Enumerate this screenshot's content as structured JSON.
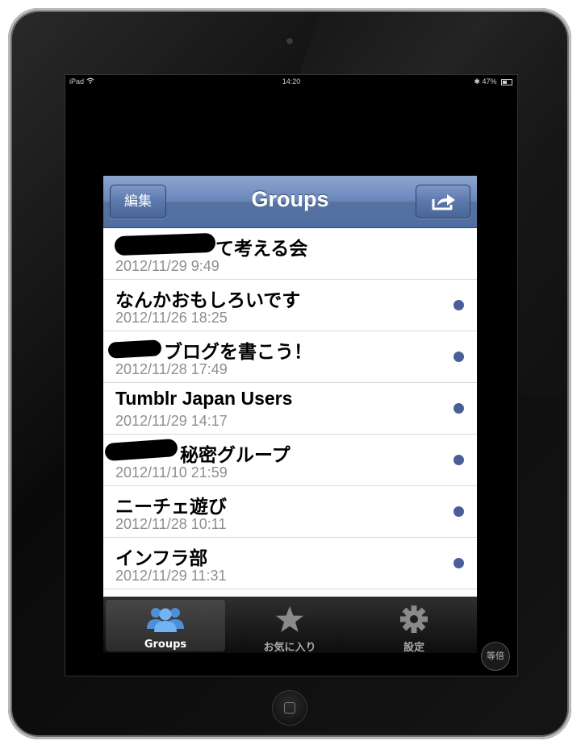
{
  "status_bar": {
    "carrier": "iPad",
    "time": "14:20",
    "battery": "47%"
  },
  "navbar": {
    "title": "Groups",
    "edit_label": "編集"
  },
  "groups": [
    {
      "title": "て考える会",
      "date": "2012/11/29 9:49",
      "unread": false
    },
    {
      "title": "なんかおもしろいです",
      "date": "2012/11/26 18:25",
      "unread": true
    },
    {
      "title": "ブログを書こう！",
      "date": "2012/11/28 17:49",
      "unread": true
    },
    {
      "title": "Tumblr Japan Users",
      "date": "2012/11/29 14:17",
      "unread": true
    },
    {
      "title": "秘密グループ",
      "date": "2012/11/10 21:59",
      "unread": true
    },
    {
      "title": "ニーチェ遊び",
      "date": "2012/11/28 10:11",
      "unread": true
    },
    {
      "title": "インフラ部",
      "date": "2012/11/29 11:31",
      "unread": true
    }
  ],
  "tabs": [
    {
      "label": "Groups",
      "icon": "groups-icon",
      "active": true
    },
    {
      "label": "お気に入り",
      "icon": "star-icon",
      "active": false
    },
    {
      "label": "設定",
      "icon": "gear-icon",
      "active": false
    }
  ],
  "zoom_button": "等倍",
  "colors": {
    "nav_blue": "#5b78ab",
    "unread_dot": "#4a5f98",
    "tab_icon_blue": "#5aa0e8"
  }
}
